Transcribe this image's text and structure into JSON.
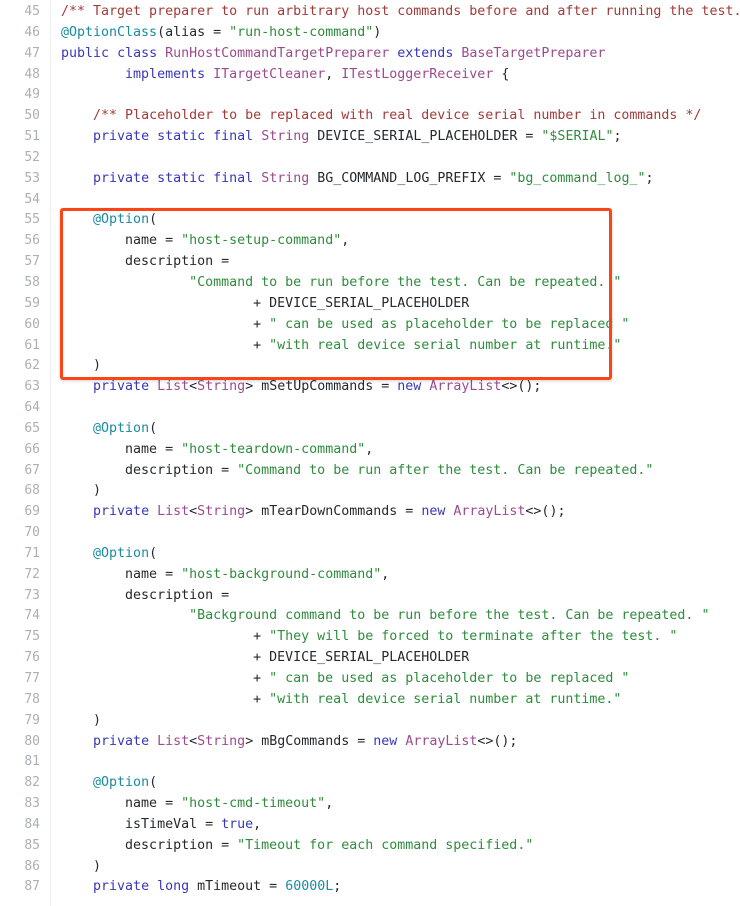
{
  "viewer": {
    "name": "java-source-code-viewer",
    "language": "Java",
    "first_line_number": 45,
    "last_line_number": 87,
    "background_color": "#ffffff",
    "gutter_color": "#aab0b6",
    "colors": {
      "comment": "#a33a3a",
      "annotation": "#1a8ba0",
      "keyword": "#3838b8",
      "class": "#9c4a8e",
      "string": "#2f8c3d",
      "number": "#1a8ba0",
      "plain": "#24292e",
      "highlight_border": "#fa4616"
    }
  },
  "highlight": {
    "name": "code-highlight-box",
    "color": "#fa4616",
    "covers_lines": "55-62",
    "label": ""
  },
  "lines": [
    {
      "n": "45",
      "tokens": [
        {
          "t": "com",
          "s": "/** Target preparer to run arbitrary host commands before and after running the test. */"
        }
      ]
    },
    {
      "n": "46",
      "tokens": [
        {
          "t": "ann",
          "s": "@OptionClass"
        },
        {
          "t": "pln",
          "s": "("
        },
        {
          "t": "pln",
          "s": "alias"
        },
        {
          "t": "pln",
          "s": " = "
        },
        {
          "t": "str",
          "s": "\"run-host-command\""
        },
        {
          "t": "pln",
          "s": ")"
        }
      ]
    },
    {
      "n": "47",
      "tokens": [
        {
          "t": "key",
          "s": "public"
        },
        {
          "t": "pln",
          "s": " "
        },
        {
          "t": "key",
          "s": "class"
        },
        {
          "t": "pln",
          "s": " "
        },
        {
          "t": "cls",
          "s": "RunHostCommandTargetPreparer"
        },
        {
          "t": "pln",
          "s": " "
        },
        {
          "t": "key",
          "s": "extends"
        },
        {
          "t": "pln",
          "s": " "
        },
        {
          "t": "cls",
          "s": "BaseTargetPreparer"
        }
      ]
    },
    {
      "n": "48",
      "tokens": [
        {
          "t": "pln",
          "s": "        "
        },
        {
          "t": "key",
          "s": "implements"
        },
        {
          "t": "pln",
          "s": " "
        },
        {
          "t": "cls",
          "s": "ITargetCleaner"
        },
        {
          "t": "pln",
          "s": ", "
        },
        {
          "t": "cls",
          "s": "ITestLoggerReceiver"
        },
        {
          "t": "pln",
          "s": " {"
        }
      ]
    },
    {
      "n": "49",
      "tokens": []
    },
    {
      "n": "50",
      "tokens": [
        {
          "t": "pln",
          "s": "    "
        },
        {
          "t": "com",
          "s": "/** Placeholder to be replaced with real device serial number in commands */"
        }
      ]
    },
    {
      "n": "51",
      "tokens": [
        {
          "t": "pln",
          "s": "    "
        },
        {
          "t": "key",
          "s": "private"
        },
        {
          "t": "pln",
          "s": " "
        },
        {
          "t": "key",
          "s": "static"
        },
        {
          "t": "pln",
          "s": " "
        },
        {
          "t": "key",
          "s": "final"
        },
        {
          "t": "pln",
          "s": " "
        },
        {
          "t": "cls",
          "s": "String"
        },
        {
          "t": "pln",
          "s": " DEVICE_SERIAL_PLACEHOLDER = "
        },
        {
          "t": "str",
          "s": "\"$SERIAL\""
        },
        {
          "t": "pln",
          "s": ";"
        }
      ]
    },
    {
      "n": "52",
      "tokens": []
    },
    {
      "n": "53",
      "tokens": [
        {
          "t": "pln",
          "s": "    "
        },
        {
          "t": "key",
          "s": "private"
        },
        {
          "t": "pln",
          "s": " "
        },
        {
          "t": "key",
          "s": "static"
        },
        {
          "t": "pln",
          "s": " "
        },
        {
          "t": "key",
          "s": "final"
        },
        {
          "t": "pln",
          "s": " "
        },
        {
          "t": "cls",
          "s": "String"
        },
        {
          "t": "pln",
          "s": " BG_COMMAND_LOG_PREFIX = "
        },
        {
          "t": "str",
          "s": "\"bg_command_log_\""
        },
        {
          "t": "pln",
          "s": ";"
        }
      ]
    },
    {
      "n": "54",
      "tokens": []
    },
    {
      "n": "55",
      "tokens": [
        {
          "t": "pln",
          "s": "    "
        },
        {
          "t": "ann",
          "s": "@Option"
        },
        {
          "t": "pln",
          "s": "("
        }
      ]
    },
    {
      "n": "56",
      "tokens": [
        {
          "t": "pln",
          "s": "        name = "
        },
        {
          "t": "str",
          "s": "\"host-setup-command\""
        },
        {
          "t": "pln",
          "s": ","
        }
      ]
    },
    {
      "n": "57",
      "tokens": [
        {
          "t": "pln",
          "s": "        description ="
        }
      ]
    },
    {
      "n": "58",
      "tokens": [
        {
          "t": "pln",
          "s": "                "
        },
        {
          "t": "str",
          "s": "\"Command to be run before the test. Can be repeated. \""
        }
      ]
    },
    {
      "n": "59",
      "tokens": [
        {
          "t": "pln",
          "s": "                        + DEVICE_SERIAL_PLACEHOLDER"
        }
      ]
    },
    {
      "n": "60",
      "tokens": [
        {
          "t": "pln",
          "s": "                        + "
        },
        {
          "t": "str",
          "s": "\" can be used as placeholder to be replaced \""
        }
      ]
    },
    {
      "n": "61",
      "tokens": [
        {
          "t": "pln",
          "s": "                        + "
        },
        {
          "t": "str",
          "s": "\"with real device serial number at runtime.\""
        }
      ]
    },
    {
      "n": "62",
      "tokens": [
        {
          "t": "pln",
          "s": "    )"
        }
      ]
    },
    {
      "n": "63",
      "tokens": [
        {
          "t": "pln",
          "s": "    "
        },
        {
          "t": "key",
          "s": "private"
        },
        {
          "t": "pln",
          "s": " "
        },
        {
          "t": "cls",
          "s": "List"
        },
        {
          "t": "pln",
          "s": "<"
        },
        {
          "t": "cls",
          "s": "String"
        },
        {
          "t": "pln",
          "s": "> mSetUpCommands = "
        },
        {
          "t": "key",
          "s": "new"
        },
        {
          "t": "pln",
          "s": " "
        },
        {
          "t": "cls",
          "s": "ArrayList"
        },
        {
          "t": "pln",
          "s": "<>();"
        }
      ]
    },
    {
      "n": "64",
      "tokens": []
    },
    {
      "n": "65",
      "tokens": [
        {
          "t": "pln",
          "s": "    "
        },
        {
          "t": "ann",
          "s": "@Option"
        },
        {
          "t": "pln",
          "s": "("
        }
      ]
    },
    {
      "n": "66",
      "tokens": [
        {
          "t": "pln",
          "s": "        name = "
        },
        {
          "t": "str",
          "s": "\"host-teardown-command\""
        },
        {
          "t": "pln",
          "s": ","
        }
      ]
    },
    {
      "n": "67",
      "tokens": [
        {
          "t": "pln",
          "s": "        description = "
        },
        {
          "t": "str",
          "s": "\"Command to be run after the test. Can be repeated.\""
        }
      ]
    },
    {
      "n": "68",
      "tokens": [
        {
          "t": "pln",
          "s": "    )"
        }
      ]
    },
    {
      "n": "69",
      "tokens": [
        {
          "t": "pln",
          "s": "    "
        },
        {
          "t": "key",
          "s": "private"
        },
        {
          "t": "pln",
          "s": " "
        },
        {
          "t": "cls",
          "s": "List"
        },
        {
          "t": "pln",
          "s": "<"
        },
        {
          "t": "cls",
          "s": "String"
        },
        {
          "t": "pln",
          "s": "> mTearDownCommands = "
        },
        {
          "t": "key",
          "s": "new"
        },
        {
          "t": "pln",
          "s": " "
        },
        {
          "t": "cls",
          "s": "ArrayList"
        },
        {
          "t": "pln",
          "s": "<>();"
        }
      ]
    },
    {
      "n": "70",
      "tokens": []
    },
    {
      "n": "71",
      "tokens": [
        {
          "t": "pln",
          "s": "    "
        },
        {
          "t": "ann",
          "s": "@Option"
        },
        {
          "t": "pln",
          "s": "("
        }
      ]
    },
    {
      "n": "72",
      "tokens": [
        {
          "t": "pln",
          "s": "        name = "
        },
        {
          "t": "str",
          "s": "\"host-background-command\""
        },
        {
          "t": "pln",
          "s": ","
        }
      ]
    },
    {
      "n": "73",
      "tokens": [
        {
          "t": "pln",
          "s": "        description ="
        }
      ]
    },
    {
      "n": "74",
      "tokens": [
        {
          "t": "pln",
          "s": "                "
        },
        {
          "t": "str",
          "s": "\"Background command to be run before the test. Can be repeated. \""
        }
      ]
    },
    {
      "n": "75",
      "tokens": [
        {
          "t": "pln",
          "s": "                        + "
        },
        {
          "t": "str",
          "s": "\"They will be forced to terminate after the test. \""
        }
      ]
    },
    {
      "n": "76",
      "tokens": [
        {
          "t": "pln",
          "s": "                        + DEVICE_SERIAL_PLACEHOLDER"
        }
      ]
    },
    {
      "n": "77",
      "tokens": [
        {
          "t": "pln",
          "s": "                        + "
        },
        {
          "t": "str",
          "s": "\" can be used as placeholder to be replaced \""
        }
      ]
    },
    {
      "n": "78",
      "tokens": [
        {
          "t": "pln",
          "s": "                        + "
        },
        {
          "t": "str",
          "s": "\"with real device serial number at runtime.\""
        }
      ]
    },
    {
      "n": "79",
      "tokens": [
        {
          "t": "pln",
          "s": "    )"
        }
      ]
    },
    {
      "n": "80",
      "tokens": [
        {
          "t": "pln",
          "s": "    "
        },
        {
          "t": "key",
          "s": "private"
        },
        {
          "t": "pln",
          "s": " "
        },
        {
          "t": "cls",
          "s": "List"
        },
        {
          "t": "pln",
          "s": "<"
        },
        {
          "t": "cls",
          "s": "String"
        },
        {
          "t": "pln",
          "s": "> mBgCommands = "
        },
        {
          "t": "key",
          "s": "new"
        },
        {
          "t": "pln",
          "s": " "
        },
        {
          "t": "cls",
          "s": "ArrayList"
        },
        {
          "t": "pln",
          "s": "<>();"
        }
      ]
    },
    {
      "n": "81",
      "tokens": []
    },
    {
      "n": "82",
      "tokens": [
        {
          "t": "pln",
          "s": "    "
        },
        {
          "t": "ann",
          "s": "@Option"
        },
        {
          "t": "pln",
          "s": "("
        }
      ]
    },
    {
      "n": "83",
      "tokens": [
        {
          "t": "pln",
          "s": "        name = "
        },
        {
          "t": "str",
          "s": "\"host-cmd-timeout\""
        },
        {
          "t": "pln",
          "s": ","
        }
      ]
    },
    {
      "n": "84",
      "tokens": [
        {
          "t": "pln",
          "s": "        isTimeVal = "
        },
        {
          "t": "key",
          "s": "true"
        },
        {
          "t": "pln",
          "s": ","
        }
      ]
    },
    {
      "n": "85",
      "tokens": [
        {
          "t": "pln",
          "s": "        description = "
        },
        {
          "t": "str",
          "s": "\"Timeout for each command specified.\""
        }
      ]
    },
    {
      "n": "86",
      "tokens": [
        {
          "t": "pln",
          "s": "    )"
        }
      ]
    },
    {
      "n": "87",
      "tokens": [
        {
          "t": "pln",
          "s": "    "
        },
        {
          "t": "key",
          "s": "private"
        },
        {
          "t": "pln",
          "s": " "
        },
        {
          "t": "key",
          "s": "long"
        },
        {
          "t": "pln",
          "s": " mTimeout = "
        },
        {
          "t": "num",
          "s": "60000L"
        },
        {
          "t": "pln",
          "s": ";"
        }
      ]
    }
  ]
}
